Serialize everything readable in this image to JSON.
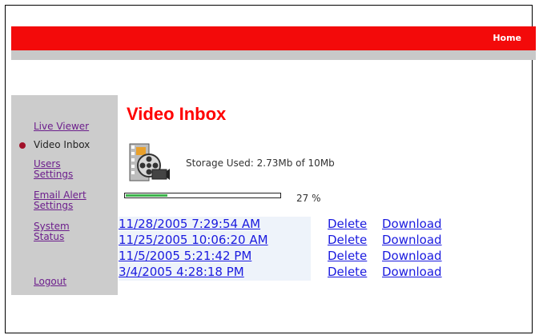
{
  "header": {
    "home_label": "Home",
    "accent_color": "#f30a0a"
  },
  "sidebar": {
    "items": [
      {
        "label": "Live Viewer"
      },
      {
        "label": "Video Inbox",
        "current": true
      },
      {
        "label": "Users\nSettings"
      },
      {
        "label": "Email Alert\nSettings"
      },
      {
        "label": "System\nStatus"
      },
      {
        "label": "Logout"
      }
    ]
  },
  "main": {
    "title": "Video Inbox",
    "storage_text": "Storage Used: 2.73Mb of 10Mb",
    "storage_percent_value": 27,
    "storage_percent_label": "27 %",
    "icon": "film-reel-icon",
    "videos": [
      {
        "date": "11/28/2005 7:29:54 AM",
        "delete": "Delete",
        "download": "Download"
      },
      {
        "date": "11/25/2005 10:06:20 AM",
        "delete": "Delete",
        "download": "Download"
      },
      {
        "date": "11/5/2005 5:21:42 PM",
        "delete": "Delete",
        "download": "Download"
      },
      {
        "date": "3/4/2005 4:28:18 PM",
        "delete": "Delete",
        "download": "Download"
      }
    ]
  }
}
